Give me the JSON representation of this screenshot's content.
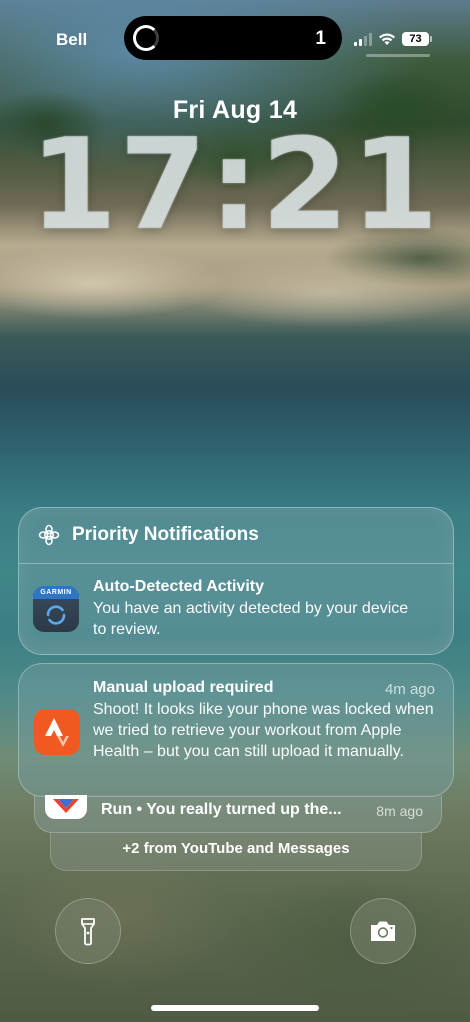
{
  "status_bar": {
    "carrier": "Bell",
    "activity_count": "1",
    "battery": "73"
  },
  "lock_screen": {
    "date": "Fri Aug 14",
    "time": "17:21"
  },
  "priority": {
    "title": "Priority Notifications",
    "notification": {
      "app_icon_text": "GARMIN",
      "title": "Auto-Detected Activity",
      "body": "You have an activity detected by your device to review."
    }
  },
  "strava_notification": {
    "title": "Manual upload required",
    "time": "4m ago",
    "body": "Shoot! It looks like your phone was locked when we tried to retrieve your workout from Apple Health – but you can still upload it manually."
  },
  "stacked_notification": {
    "text": "Run • You really turned up the...",
    "time": "8m ago"
  },
  "more_notifications": "+2 from YouTube and Messages",
  "colors": {
    "strava_orange": "#f05a22",
    "garmin_blue": "#2f75c6"
  }
}
